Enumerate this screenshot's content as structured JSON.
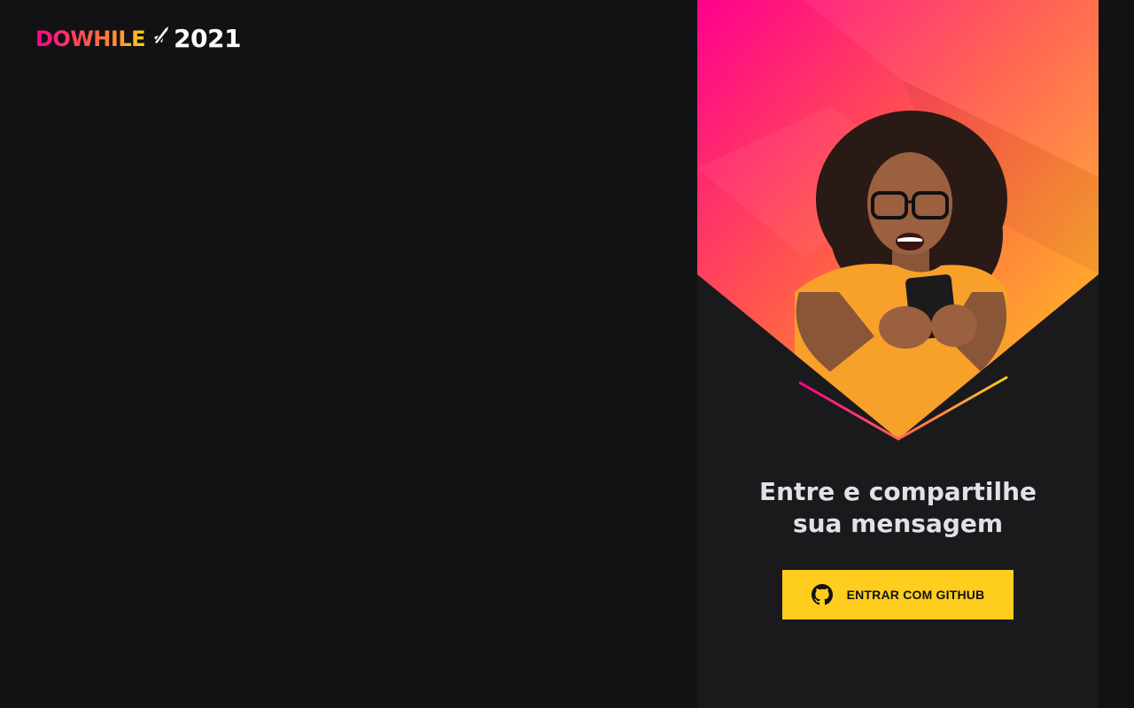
{
  "logo": {
    "brand": "DOWHILE",
    "year": "2021",
    "mark_icon": "rocket-icon"
  },
  "login": {
    "title_line1": "Entre e compartilhe",
    "title_line2": "sua mensagem",
    "button_label": "ENTRAR COM GITHUB",
    "button_icon": "github-icon"
  },
  "colors": {
    "background": "#121214",
    "panel": "#1a1a1d",
    "accent_yellow": "#ffcd1e",
    "gradient_pink": "#ff008e",
    "gradient_orange": "#ff8a3d",
    "text_light": "#e1e1e6"
  }
}
